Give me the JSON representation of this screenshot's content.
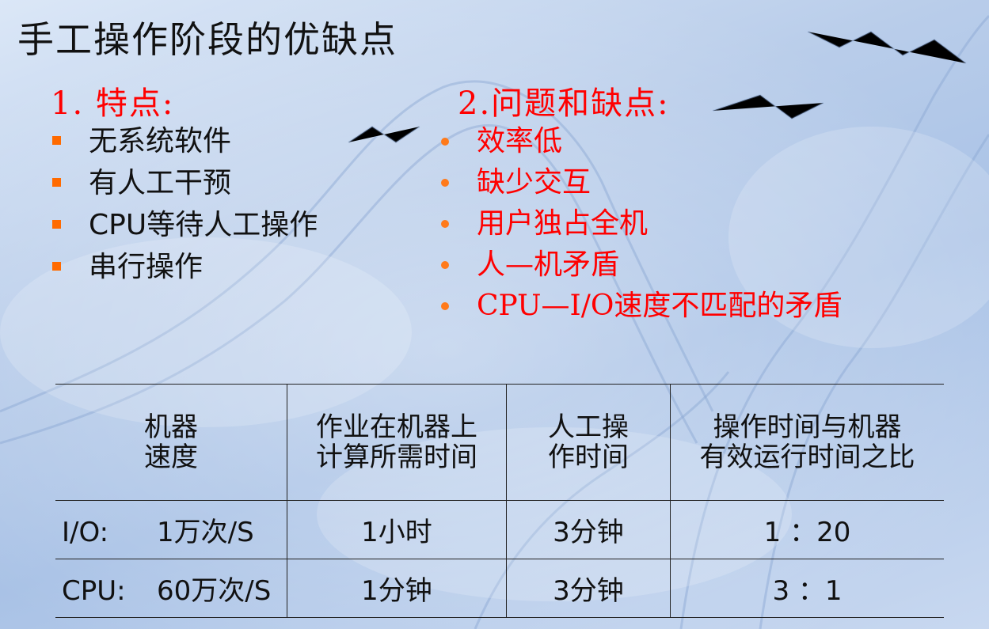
{
  "title": "手工操作阶段的优缺点",
  "features": {
    "heading": "1. 特点:",
    "items": [
      "无系统软件",
      "有人工干预",
      "CPU等待人工操作",
      "串行操作"
    ]
  },
  "problems": {
    "heading": "2.问题和缺点:",
    "items": [
      "效率低",
      "缺少交互",
      "用户独占全机",
      "人—机矛盾",
      "CPU—I/O速度不匹配的矛盾"
    ]
  },
  "table": {
    "headers": [
      [
        "机器",
        "速度"
      ],
      [
        "作业在机器上",
        "计算所需时间"
      ],
      [
        "人工操",
        "作时间"
      ],
      [
        "操作时间与机器",
        "有效运行时间之比"
      ]
    ],
    "rows": [
      {
        "label": "I/O:",
        "speed": "1万次/S",
        "compute_time": "1小时",
        "manual_time": "3分钟",
        "ratio": "1 ：20"
      },
      {
        "label": "CPU:",
        "speed": "60万次/S",
        "compute_time": "1分钟",
        "manual_time": "3分钟",
        "ratio": "3 ：1"
      }
    ]
  },
  "colors": {
    "heading": "#ff0000",
    "square_bullet": "#ff6a00",
    "round_bullet": "#ff7a1a",
    "text": "#111111"
  }
}
